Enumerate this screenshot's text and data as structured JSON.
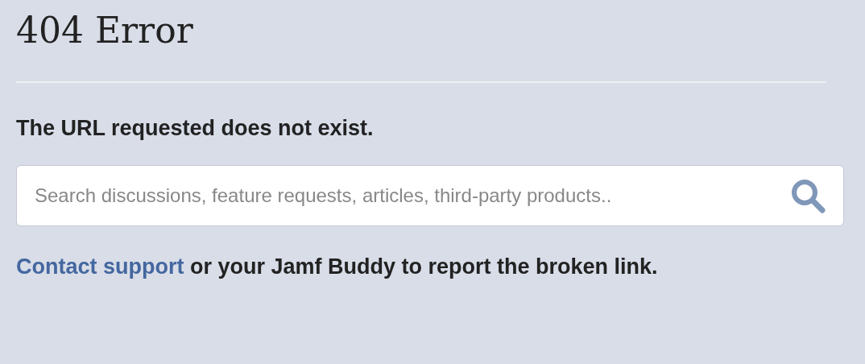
{
  "title": "404 Error",
  "message": "The URL requested does not exist.",
  "search": {
    "placeholder": "Search discussions, feature requests, articles, third-party products.."
  },
  "footer": {
    "link": "Contact support",
    "text": "or your Jamf Buddy to report the broken link."
  }
}
